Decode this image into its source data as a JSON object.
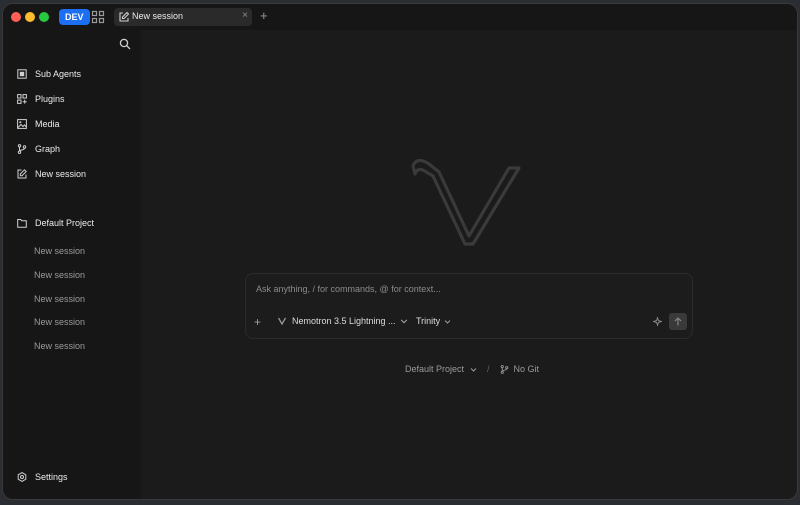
{
  "titlebar": {
    "dev_badge": "DEV",
    "active_tab": "New session",
    "tab_close": "×",
    "new_tab": "+"
  },
  "sidebar": {
    "nav": [
      {
        "label": "Sub Agents",
        "icon": "square-icon"
      },
      {
        "label": "Plugins",
        "icon": "grid-plus-icon"
      },
      {
        "label": "Media",
        "icon": "image-icon"
      },
      {
        "label": "Graph",
        "icon": "branch-icon"
      },
      {
        "label": "New session",
        "icon": "edit-icon"
      }
    ],
    "project": {
      "label": "Default Project",
      "icon": "folder-icon"
    },
    "sessions": [
      "New session",
      "New session",
      "New session",
      "New session",
      "New session"
    ],
    "settings_label": "Settings"
  },
  "composer": {
    "placeholder": "Ask anything, / for commands, @ for context...",
    "value": "",
    "plus": "+",
    "model": "Nemotron 3.5 Lightning ...",
    "agent": "Trinity"
  },
  "footer": {
    "project": "Default Project",
    "separator": "/",
    "git": "No Git"
  },
  "colors": {
    "accent": "#1d6ff2",
    "background": "#1b1b1b",
    "sidebar": "#161616"
  }
}
